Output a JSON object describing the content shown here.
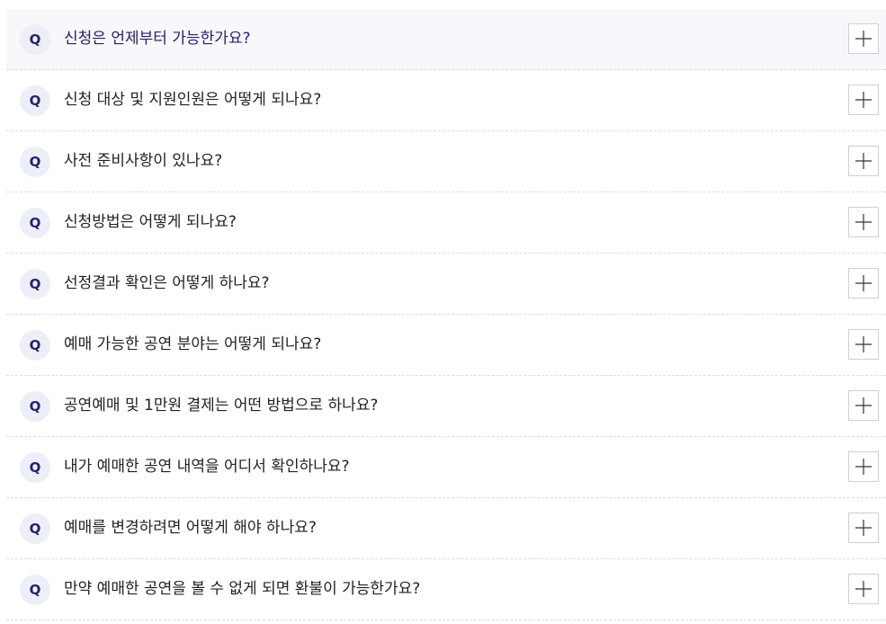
{
  "faq": {
    "badge_label": "Q",
    "items": [
      {
        "question": "신청은 언제부터 가능한가요?",
        "active": true
      },
      {
        "question": "신청 대상 및 지원인원은 어떻게 되나요?",
        "active": false
      },
      {
        "question": "사전 준비사항이 있나요?",
        "active": false
      },
      {
        "question": "신청방법은 어떻게 되나요?",
        "active": false
      },
      {
        "question": "선정결과 확인은 어떻게 하나요?",
        "active": false
      },
      {
        "question": "예매 가능한 공연 분야는 어떻게 되나요?",
        "active": false
      },
      {
        "question": "공연예매 및 1만원 결제는 어떤 방법으로 하나요?",
        "active": false
      },
      {
        "question": "내가 예매한 공연 내역을 어디서 확인하나요?",
        "active": false
      },
      {
        "question": "예매를 변경하려면 어떻게 해야 하나요?",
        "active": false
      },
      {
        "question": "만약 예매한 공연을 볼 수 없게 되면 환불이 가능한가요?",
        "active": false
      }
    ]
  },
  "icons": {
    "toggle": "plus-icon"
  },
  "colors": {
    "accent": "#23236b",
    "badge_bg": "#eeeef8",
    "active_row_bg": "#f7f7fc",
    "divider": "#dcdce3"
  }
}
